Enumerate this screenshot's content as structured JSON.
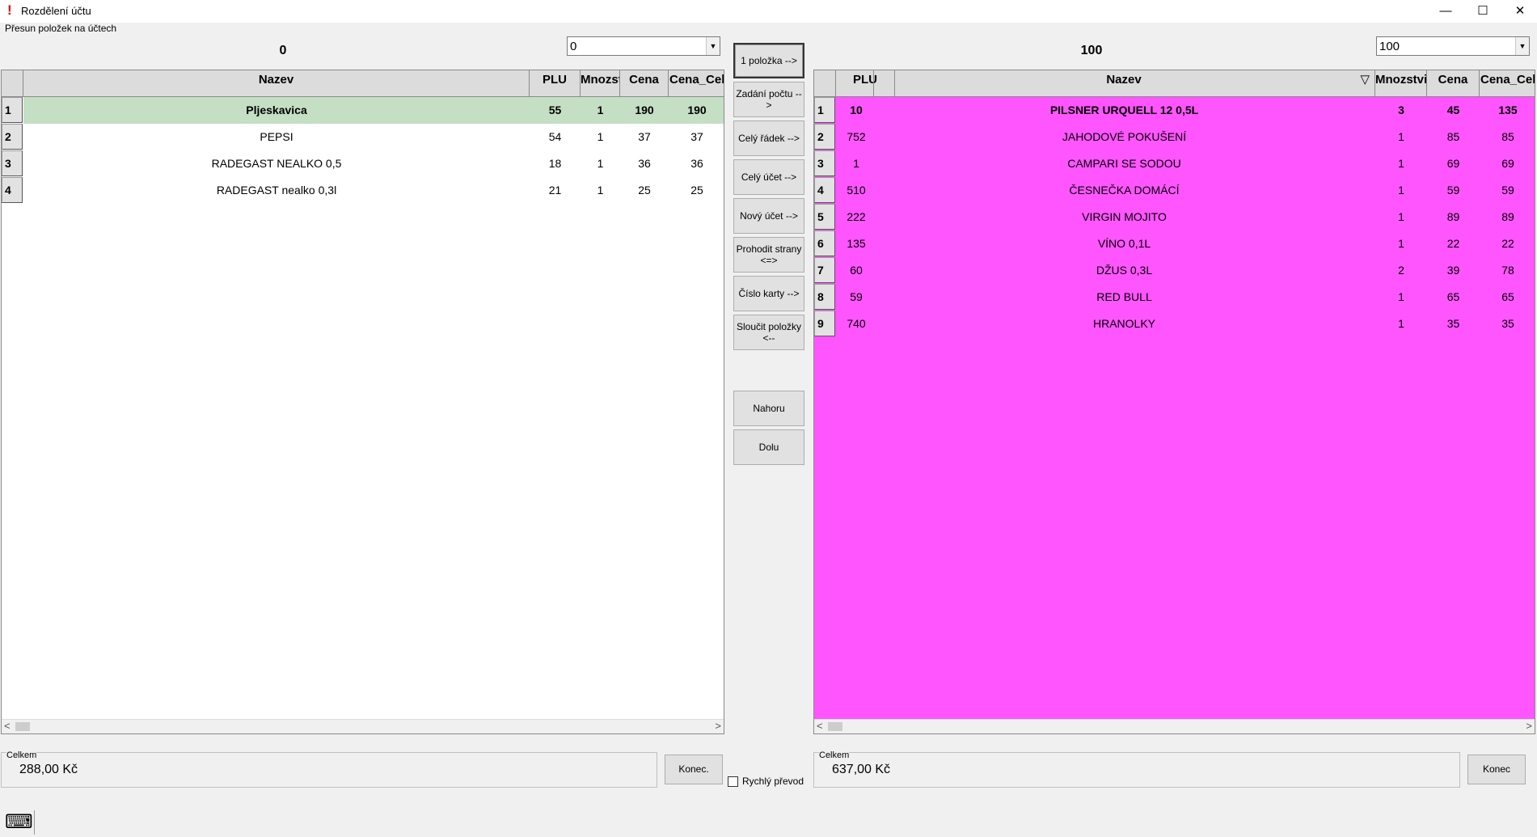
{
  "window": {
    "title": "Rozdělení účtu",
    "group_caption": "Přesun položek na účtech"
  },
  "left": {
    "number": "0",
    "combo_value": "0",
    "headers": [
      "Nazev",
      "PLU",
      "Mnozstv",
      "Cena",
      "Cena_Celk"
    ],
    "rows": [
      {
        "no": "1",
        "name": "Pljeskavica",
        "plu": "55",
        "qty": "1",
        "price": "190",
        "total": "190"
      },
      {
        "no": "2",
        "name": "PEPSI",
        "plu": "54",
        "qty": "1",
        "price": "37",
        "total": "37"
      },
      {
        "no": "3",
        "name": "RADEGAST NEALKO 0,5",
        "plu": "18",
        "qty": "1",
        "price": "36",
        "total": "36"
      },
      {
        "no": "4",
        "name": "RADEGAST nealko 0,3l",
        "plu": "21",
        "qty": "1",
        "price": "25",
        "total": "25"
      }
    ],
    "selected_row": 1,
    "total_caption": "Celkem",
    "total_value": "288,00 Kč",
    "end_button": "Konec."
  },
  "right": {
    "number": "100",
    "combo_value": "100",
    "headers": [
      "PLU",
      "Nazev",
      "Mnozstvi",
      "Cena",
      "Cena_Celk"
    ],
    "sort_indicator": "▽",
    "rows": [
      {
        "no": "1",
        "plu": "10",
        "name": "PILSNER URQUELL 12 0,5L",
        "qty": "3",
        "price": "45",
        "total": "135"
      },
      {
        "no": "2",
        "plu": "752",
        "name": "JAHODOVÉ POKUŠENÍ",
        "qty": "1",
        "price": "85",
        "total": "85"
      },
      {
        "no": "3",
        "plu": "1",
        "name": "CAMPARI SE SODOU",
        "qty": "1",
        "price": "69",
        "total": "69"
      },
      {
        "no": "4",
        "plu": "510",
        "name": "ČESNEČKA DOMÁCÍ",
        "qty": "1",
        "price": "59",
        "total": "59"
      },
      {
        "no": "5",
        "plu": "222",
        "name": "VIRGIN MOJITO",
        "qty": "1",
        "price": "89",
        "total": "89"
      },
      {
        "no": "6",
        "plu": "135",
        "name": "VÍNO 0,1L",
        "qty": "1",
        "price": "22",
        "total": "22"
      },
      {
        "no": "7",
        "plu": "60",
        "name": "DŽUS 0,3L",
        "qty": "2",
        "price": "39",
        "total": "78"
      },
      {
        "no": "8",
        "plu": "59",
        "name": "RED BULL",
        "qty": "1",
        "price": "65",
        "total": "65"
      },
      {
        "no": "9",
        "plu": "740",
        "name": "HRANOLKY",
        "qty": "1",
        "price": "35",
        "total": "35"
      }
    ],
    "background_color": "#ff55ff",
    "total_caption": "Celkem",
    "total_value": "637,00 Kč",
    "end_button": "Konec"
  },
  "actions": {
    "one_item": "1 položka -->",
    "enter_count": "Zadání počtu -->",
    "whole_row": "Celý řádek -->",
    "whole_bill": "Celý účet -->",
    "new_bill": "Nový účet -->",
    "swap_sides_1": "Prohodit strany",
    "swap_sides_2": "<=>",
    "card_number": "Číslo karty -->",
    "merge_items_1": "Sloučit položky",
    "merge_items_2": "<--",
    "up": "Nahoru",
    "down": "Dolu",
    "quick_transfer": "Rychlý převod"
  },
  "colors": {
    "selected_row": "#c4dfc4",
    "right_grid": "#ff55ff"
  },
  "icons": [
    "warning-icon",
    "minimize-icon",
    "maximize-icon",
    "close-icon",
    "keyboard-icon",
    "dropdown-arrow-icon"
  ]
}
